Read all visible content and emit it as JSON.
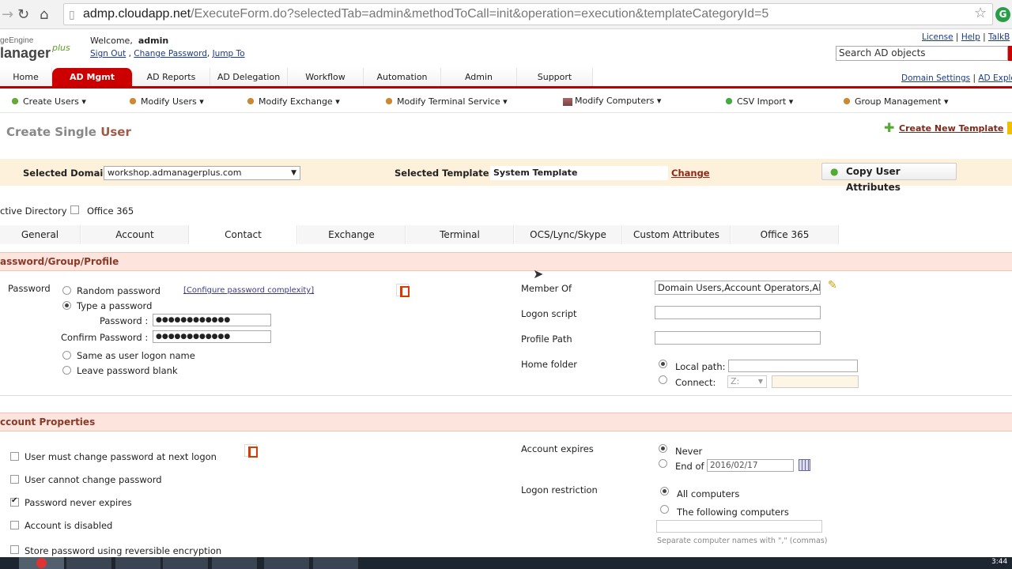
{
  "browser": {
    "url_host": "admp.cloudapp.net",
    "url_path": "/ExecuteForm.do?selectedTab=admin&methodToCall=init&operation=execution&templateCategoryId=5"
  },
  "header": {
    "logo_top": "geEngine",
    "logo_main": "lanager",
    "logo_plus": "plus",
    "welcome": "Welcome,",
    "user": "admin",
    "sign_out": "Sign Out",
    "change_password": "Change Password",
    "jump_to": "Jump To",
    "license": "License",
    "help": "Help",
    "talk": "TalkB",
    "search_placeholder": "Search AD objects",
    "domain_settings": "Domain Settings",
    "ad_explorer": "AD Explo"
  },
  "top_tabs": [
    "Home",
    "AD Mgmt",
    "AD Reports",
    "AD Delegation",
    "Workflow",
    "Automation",
    "Admin",
    "Support"
  ],
  "subnav": [
    "Create Users",
    "Modify Users",
    "Modify Exchange",
    "Modify Terminal Service",
    "Modify Computers",
    "CSV Import",
    "Group Management"
  ],
  "page": {
    "title_main": "Create Single",
    "title_accent": "User",
    "create_template": "Create New Template",
    "selected_domain_label": "Selected Domain:",
    "selected_domain": "workshop.admanagerplus.com",
    "selected_template_label": "Selected Template :",
    "selected_template": "System Template",
    "change": "Change",
    "copy_attrs": "Copy User Attributes",
    "active_directory": "ctive Directory",
    "office365_check": "Office 365"
  },
  "sub_tabs": [
    "General",
    "Account",
    "Contact",
    "Exchange",
    "Terminal",
    "OCS/Lync/Skype",
    "Custom Attributes",
    "Office 365"
  ],
  "password_section": {
    "heading": "assword/Group/Profile",
    "password_label": "Password",
    "random": "Random password",
    "configure": "[Configure password complexity]",
    "type": "Type a password",
    "pw_label": "Password :",
    "pw_value": "●●●●●●●●●●●●",
    "confirm_label": "Confirm Password :",
    "confirm_value": "●●●●●●●●●●●●",
    "same_as_logon": "Same as user logon name",
    "leave_blank": "Leave password blank",
    "member_of_label": "Member Of",
    "member_of_value": "Domain Users,Account Operators,All",
    "logon_script": "Logon script",
    "profile_path": "Profile Path",
    "home_folder": "Home folder",
    "local_path": "Local path:",
    "connect": "Connect:",
    "drive": "Z:"
  },
  "account_section": {
    "heading": "ccount Properties",
    "must_change": "User must change password at next logon",
    "cannot_change": "User cannot change password",
    "never_expires": "Password never expires",
    "disabled": "Account is disabled",
    "reversible": "Store password using reversible encryption",
    "account_expires": "Account expires",
    "never": "Never",
    "end_of": "End of",
    "end_date": "2016/02/17",
    "logon_restriction": "Logon restriction",
    "all_computers": "All computers",
    "following": "The following computers",
    "hint": "Separate computer names with \",\" (commas)"
  },
  "taskbar": {
    "clock": "3:44"
  }
}
